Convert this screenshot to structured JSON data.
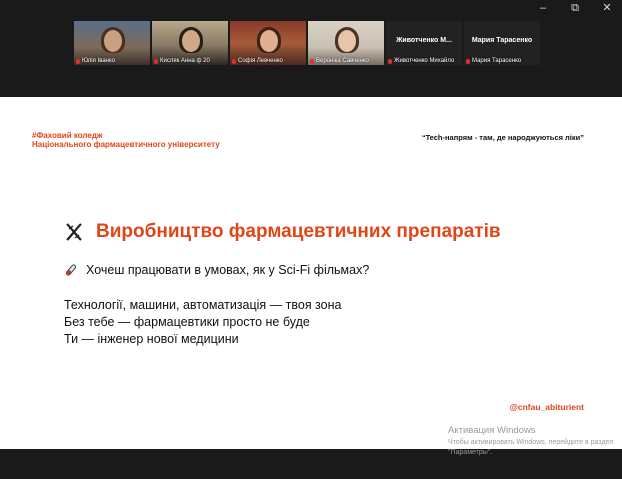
{
  "window": {
    "controls": {
      "minimize": "–",
      "maximize": "⧉",
      "close": "✕"
    }
  },
  "participants": [
    {
      "caption": "Юлія Іванко",
      "type": "video",
      "muted": true
    },
    {
      "caption": "Кисляк Анна ф 20",
      "type": "video",
      "muted": true
    },
    {
      "caption": "Софія Левченко",
      "type": "video",
      "muted": true
    },
    {
      "caption": "Вероніка Савченко",
      "type": "video",
      "muted": true,
      "active": true
    },
    {
      "display_name": "Животченко  М...",
      "caption": "Животченко Михайло",
      "type": "name",
      "muted": true
    },
    {
      "display_name": "Мария Тарасенко",
      "caption": "Мария Тарасенко",
      "type": "name",
      "muted": true
    }
  ],
  "slide": {
    "college_line1": "#Фаховий коледж",
    "college_line2": "Національного фармацевтичного університету",
    "motto": "“Tech-напрям - там, де народжуються ліки”",
    "title": "Виробництво фармацевтичних препаратів",
    "question": "Хочеш працювати в умовах, як у Sci-Fi фільмах?",
    "lines": [
      "Технології, машини, автоматизація — твоя зона",
      "Без тебе — фармацевтики просто не буде",
      "Ти — інженер нової медицини"
    ],
    "handle": "@cnfau_abiturient",
    "icons": {
      "title": "dna-icon",
      "question": "test-tube-icon"
    },
    "accent_color": "#e0461a"
  },
  "activation": {
    "title": "Активация Windows",
    "subtitle": "Чтобы активировать Windows, перейдите в раздел \"Параметры\"."
  }
}
